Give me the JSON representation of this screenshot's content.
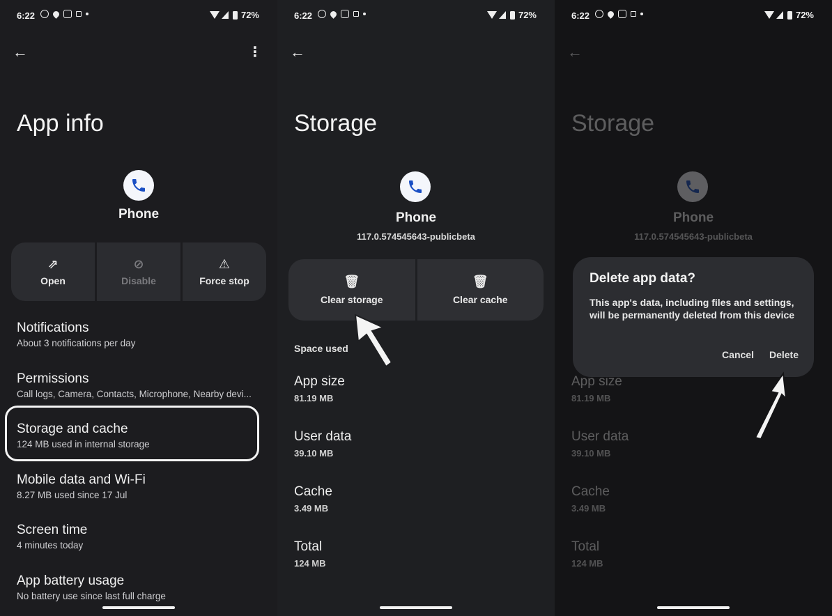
{
  "status_bar": {
    "time": "6:22",
    "battery": "72%"
  },
  "panel1": {
    "title": "App info",
    "app_name": "Phone",
    "actions": [
      {
        "label": "Open",
        "icon": "open-external-icon",
        "enabled": true
      },
      {
        "label": "Disable",
        "icon": "disable-icon",
        "enabled": false
      },
      {
        "label": "Force stop",
        "icon": "warning-triangle-icon",
        "enabled": true
      }
    ],
    "items": [
      {
        "title": "Notifications",
        "subtitle": "About 3 notifications per day"
      },
      {
        "title": "Permissions",
        "subtitle": "Call logs, Camera, Contacts, Microphone, Nearby devi..."
      },
      {
        "title": "Storage and cache",
        "subtitle": "124 MB used in internal storage"
      },
      {
        "title": "Mobile data and Wi-Fi",
        "subtitle": "8.27 MB used since 17 Jul"
      },
      {
        "title": "Screen time",
        "subtitle": "4 minutes today"
      },
      {
        "title": "App battery usage",
        "subtitle": "No battery use since last full charge"
      }
    ]
  },
  "panel2": {
    "title": "Storage",
    "app_name": "Phone",
    "version": "117.0.574545643-publicbeta",
    "clear_storage": "Clear storage",
    "clear_cache": "Clear cache",
    "section": "Space used",
    "stats": [
      {
        "label": "App size",
        "value": "81.19 MB"
      },
      {
        "label": "User data",
        "value": "39.10 MB"
      },
      {
        "label": "Cache",
        "value": "3.49 MB"
      },
      {
        "label": "Total",
        "value": "124 MB"
      }
    ]
  },
  "panel3": {
    "dialog": {
      "title": "Delete app data?",
      "body": "This app's data, including files and settings, will be permanently deleted from this device",
      "cancel": "Cancel",
      "delete": "Delete"
    }
  },
  "colors": {
    "background": "#1c1c1f",
    "card": "#2b2c30",
    "accent_icon": "#1a4fc4"
  }
}
